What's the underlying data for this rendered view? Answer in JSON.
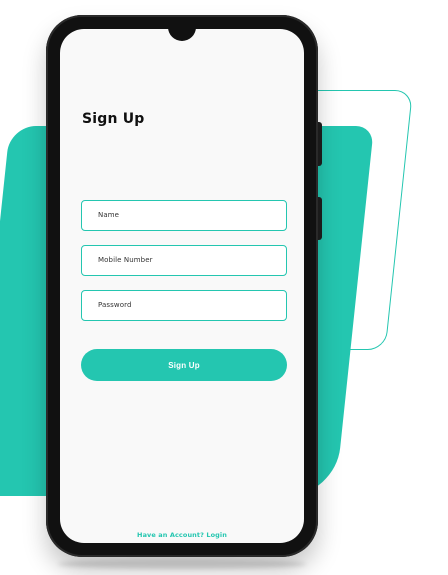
{
  "screen": {
    "title": "Sign Up"
  },
  "form": {
    "name_placeholder": "Name",
    "mobile_placeholder": "Mobile Number",
    "password_placeholder": "Password"
  },
  "actions": {
    "signup_button": "Sign Up",
    "login_link": "Have an Account? Login"
  },
  "colors": {
    "accent": "#24c6b0",
    "phone": "#111111",
    "screen": "#f9f9f9"
  }
}
